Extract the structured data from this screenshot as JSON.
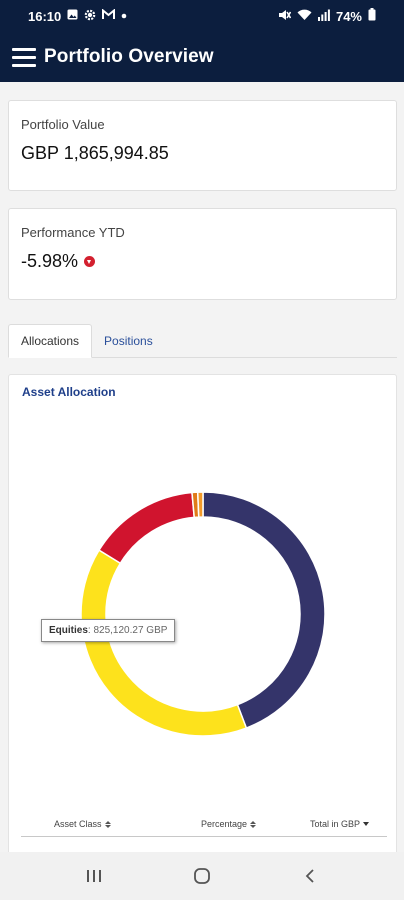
{
  "status_bar": {
    "time": "16:10",
    "battery": "74%",
    "left_icons": [
      "image-icon",
      "gear-icon",
      "gmail-icon",
      "dot-icon"
    ],
    "right_icons": [
      "mute-icon",
      "wifi-icon",
      "signal-icon",
      "battery-icon"
    ]
  },
  "header": {
    "title": "Portfolio Overview",
    "menu_icon": "hamburger-menu-icon"
  },
  "portfolio_value": {
    "label": "Portfolio Value",
    "value": "GBP 1,865,994.85"
  },
  "performance": {
    "label": "Performance YTD",
    "value": "-5.98%",
    "icon": "down-arrow-circle-icon",
    "status_color": "#d3202f"
  },
  "tabs": [
    {
      "label": "Allocations",
      "active": true
    },
    {
      "label": "Positions",
      "active": false
    }
  ],
  "allocation": {
    "title": "Asset Allocation",
    "tooltip": {
      "label": "Equities",
      "value": ": 825,120.27 GBP"
    },
    "columns": [
      {
        "label": "Asset Class",
        "sort": "both"
      },
      {
        "label": "Percentage",
        "sort": "both"
      },
      {
        "label": "Total in GBP",
        "sort": "desc"
      }
    ]
  },
  "chart_data": {
    "type": "pie",
    "donut": true,
    "slices": [
      {
        "label": "Equities",
        "value": 825120.27,
        "color": "#34346a"
      },
      {
        "label": "",
        "value": 738000,
        "color": "#fde21c"
      },
      {
        "label": "",
        "value": 276000,
        "color": "#d0142e"
      },
      {
        "label": "",
        "value": 14000,
        "color": "#e07b1a"
      },
      {
        "label": "",
        "value": 12874.58,
        "color": "#f39a2a"
      }
    ]
  },
  "nav": {
    "recents_icon": "recent-apps-icon",
    "home_icon": "home-icon",
    "back_icon": "back-icon"
  },
  "colors": {
    "header_bg": "#0c1e3e",
    "accent": "#1f3f8a",
    "link": "#2a4f9a"
  }
}
